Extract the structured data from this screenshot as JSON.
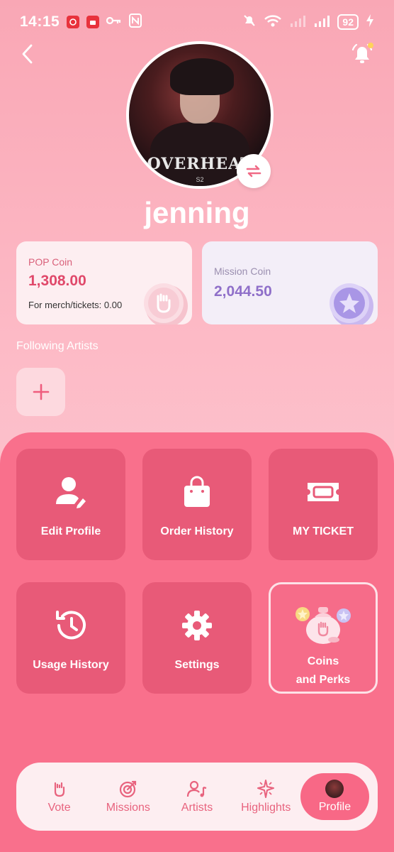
{
  "status_bar": {
    "time": "14:15",
    "battery": "92"
  },
  "profile": {
    "username": "jenning",
    "avatar_text": "OVERHEAT",
    "avatar_subtext": "S2"
  },
  "coins": {
    "pop": {
      "label": "POP Coin",
      "value": "1,308.00",
      "sub": "For merch/tickets: 0.00"
    },
    "mission": {
      "label": "Mission Coin",
      "value": "2,044.50"
    }
  },
  "following": {
    "label": "Following Artists"
  },
  "menu": {
    "edit_profile": "Edit Profile",
    "order_history": "Order History",
    "my_ticket": "MY TICKET",
    "usage_history": "Usage History",
    "settings": "Settings",
    "coins_perks_line1": "Coins",
    "coins_perks_line2": "and Perks"
  },
  "nav": {
    "vote": "Vote",
    "missions": "Missions",
    "artists": "Artists",
    "highlights": "Highlights",
    "profile": "Profile"
  },
  "colors": {
    "accent": "#f9708c",
    "tile": "#e85a78",
    "pop_value": "#e0486a",
    "mission_value": "#8f6fc9"
  }
}
